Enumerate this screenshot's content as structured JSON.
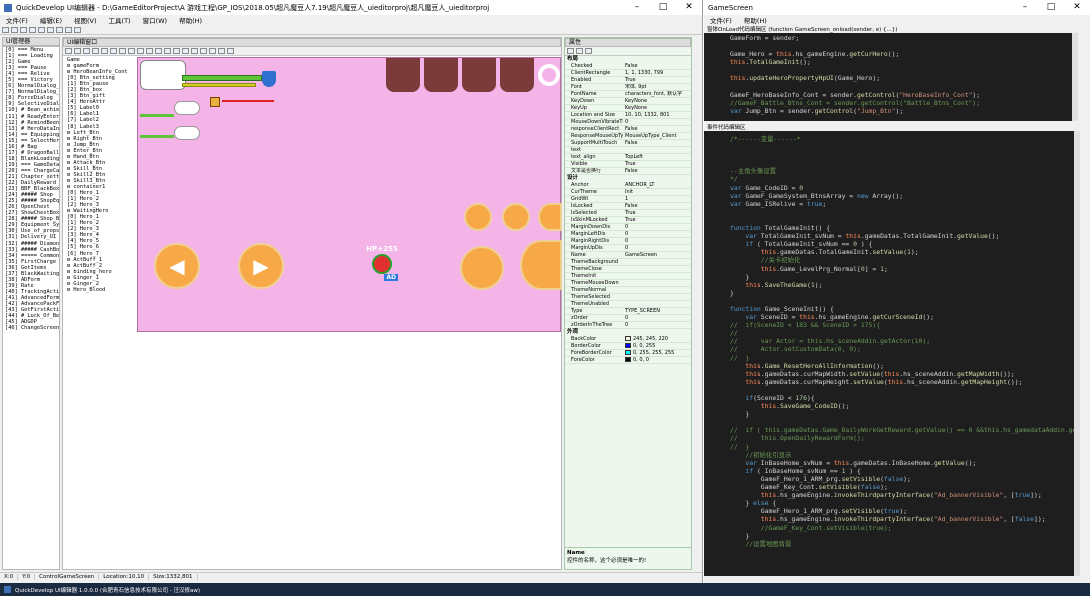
{
  "main_window": {
    "title": "QuickDevelop UI编辑器 - D:\\GameEditorProject\\A 游戏工程\\GP_IOS\\2018.05\\超凡魔豆人7.19\\超凡魔豆人_uieditorproj\\超凡魔豆人_uieditorproj",
    "menu": [
      "文件(F)",
      "编辑(E)",
      "视图(V)",
      "工具(T)",
      "窗口(W)",
      "帮助(H)"
    ],
    "ui_manager_title": "UI管理器",
    "ui_editor_title": "UI编辑窗口",
    "properties_title": "属性",
    "ui_list": [
      "[0] === Menu",
      "[1] === Loading",
      "[2] Game",
      "[3] === Pause",
      "[4] === Relive",
      "[5] === Victory",
      "[6] NormalDialog_left",
      "[7] NormalDialog_right",
      "[8] ForceDialog",
      "[9] SelectiveDialogue",
      "[10] # Bean_achieve",
      "[11] # ReadyEnterGame",
      "[12] # RemindBeenGame",
      "[13] # HeroDataInterface",
      "[14]  == Equipping",
      "[15]  == SelectHeroEquip",
      "[16]  # Bag",
      "[17]  # DragonBall",
      "[18] BlankLoading",
      "[19] === GameDatas",
      "[20] === ChargeCallback",
      "[21] Chapter_settlement",
      "[22] DailyReward",
      "[23] BBF_BlackBox",
      "[24] ##### Shop",
      "[25] ##### ShopEquipUp",
      "[26] OpenChest",
      "[27] ShowChestBox",
      "[28] ##### Shop_Box",
      "[29] Equipment Synthesis",
      "[30] Use_of_props",
      "[31] Delivery_UI",
      "[32] ##### DiamondBox",
      "[33] ##### CashBox",
      "[34] ===== CommonTipsBox",
      "[35] FirstCharge",
      "[36] GetItems",
      "[37] BlackWaiting",
      "[38] ADForm",
      "[39] Rate",
      "[40] TrackingActionForm",
      "[41] AdvancedForm",
      "[42] AdvancePackForm",
      "[43] GetFirstActivityForm",
      "[44] # Luck_Of_Bean",
      "[45] ADGDP",
      "[46] ChangeScreenLoading"
    ],
    "ui_tree": [
      "Game",
      "  ⊟ gameForm",
      "    ⊟ HeroBeanInfo_Cont",
      "      [0] Btn_setting",
      "      [1] Btn_pause",
      "      [2] Btn_box",
      "      [3] Btn_gift",
      "      [4] HeroAttr",
      "      [5] Label0",
      "      [6] Label1",
      "      [7] Label2",
      "      [8] Label3",
      "    ⊟ Left_Btn",
      "    ⊟ Right_Btn",
      "    ⊟ Jump_Btn",
      "    ⊟ Enter_Btn",
      "    ⊟ Hand_Btn",
      "    ⊟ Attack_Btn",
      "    ⊟ Skill_Btn",
      "    ⊟ Skill2_Btn",
      "    ⊟ Skill3_Btn",
      "    ⊟ container1",
      "      [0] Hero_1",
      "      [1] Hero_2",
      "      [2] Hero_3",
      "    ⊟ WaitingHero",
      "      [0] Hero_1",
      "      [1] Hero_2",
      "      [2] Hero_3",
      "      [3] Hero_4",
      "      [4] Hero_5",
      "      [5] Hero_6",
      "      [6] Hero_7",
      "    ⊟ ActBuff_1",
      "    ⊟ ActBuff_2",
      "    ⊟ binding_hero",
      "    ⊟ Ginger_1",
      "    ⊟ Ginger_2",
      "    ⊟ Hero_Blood"
    ],
    "hp_label": "HP+255",
    "ad_label": "AD",
    "properties": {
      "section_layout": "布局",
      "layout_rows": [
        [
          "Checked",
          "False"
        ],
        [
          "ClientRectangle",
          "1, 1, 1330, 799"
        ],
        [
          "Enabled",
          "True"
        ],
        [
          "Font",
          "宋体, 9pt"
        ],
        [
          "FontName",
          "characters_font, 默认字"
        ],
        [
          "KeyDown",
          "KeyNone"
        ],
        [
          "KeyUp",
          "KeyNone"
        ],
        [
          "Location and Size",
          "10, 10, 1332, 801"
        ],
        [
          "MouseDownVibrateTime",
          "0"
        ],
        [
          "responseClientRect",
          "False"
        ],
        [
          "ResponseMouseUpType",
          "MouseUpType_Client"
        ],
        [
          "SupportMultiTouch",
          "False"
        ],
        [
          "text",
          ""
        ],
        [
          "text_align",
          "TopLeft"
        ],
        [
          "Visible",
          "True"
        ],
        [
          "文本是否换行",
          "False"
        ]
      ],
      "section_design": "设计",
      "design_rows": [
        [
          "Anchor",
          "ANCHOR_LT"
        ],
        [
          "CurTheme",
          "Init"
        ],
        [
          "GridWt",
          "1"
        ],
        [
          "IsLocked",
          "False"
        ],
        [
          "IsSelected",
          "True"
        ],
        [
          "IsSkinMLocked",
          "True"
        ],
        [
          "MarginDownDis",
          "0"
        ],
        [
          "MarginLeftDis",
          "0"
        ],
        [
          "MarginRightDis",
          "0"
        ],
        [
          "MarginUpDis",
          "0"
        ],
        [
          "Name",
          "GameScreen"
        ],
        [
          "ThemeBackground",
          ""
        ],
        [
          "ThemeClose",
          ""
        ],
        [
          "ThemeInit",
          ""
        ],
        [
          "ThemeMouseDown",
          ""
        ],
        [
          "ThemeNormal",
          ""
        ],
        [
          "ThemeSelected",
          ""
        ],
        [
          "ThemeUnabled",
          ""
        ],
        [
          "Type",
          "TYPE_SCREEN"
        ],
        [
          "zOrder",
          "0"
        ],
        [
          "zOrderInTheTree",
          "0"
        ]
      ],
      "section_appearance": "外观",
      "appearance_rows": [
        [
          "BackColor",
          "245, 245, 220",
          "#f5f5dc"
        ],
        [
          "BorderColor",
          "0, 0, 255",
          "#0000ff"
        ],
        [
          "ForeBorderColor",
          "0, 255, 255, 255",
          "#00ffff"
        ],
        [
          "ForeColor",
          "0, 0, 0",
          "#000000"
        ]
      ],
      "desc_name": "Name",
      "desc_text": "控件的名称，这个必须是唯一的!"
    },
    "status": [
      "X:0",
      "Y:0",
      "ControlGameScreen",
      "Location:10,10",
      "Size:1332,801"
    ],
    "taskbar_title": "QuickDevelop UI编辑器 1.0.0.0 (合肥青石信息技术有限公司 - 汪汉修aw)"
  },
  "code_window": {
    "title": "GameScreen",
    "menu": [
      "文件(F)",
      "帮助(H)"
    ],
    "sub_title": "窗体OnLoad代码编辑区 (function GameScreen_onload(sender, e) {...})",
    "event_title": "事件代码编辑区",
    "top_lines": [
      "GameForm = sender;",
      "",
      "Game_Hero = this.hs_gameEngine.getCurHero();",
      "this.TotalGameInit();",
      "",
      "this.updateHeroPropertyHpUI(Game_Hero);",
      "",
      "GameF_HeroBaseInfo_Cont = sender.getControl(\"HeroBaseInfo_Cont\");",
      "//GameF_Battle_Btns_Cont = sender.getControl(\"Battle_Btns_Cont\");",
      "var Jump_Btn = sender.getControl(\"Jump_Btn\");"
    ],
    "event_lines": [
      "/*------变量------*",
      "",
      "",
      "",
      "--主角头像设置",
      "*/",
      "var Game_CodeID = 0",
      "var GameF_GameSystem_BtnsArray = new Array();",
      "var Game_ISRelive = true;",
      "",
      "",
      "function TotalGameInit() {",
      "    var TotalGameInit_svNum = this.gameDatas.TotalGameInit.getValue();",
      "    if ( TotalGameInit_svNum == 0 ) {",
      "        this.gameDatas.TotalGameInit.setValue(1);",
      "        //关卡初始化",
      "        this.Game_LevelPrg_Normal[0] = 1;",
      "    }",
      "    this.SaveTheGame(1);",
      "}",
      "",
      "function Game_SceneInit() {",
      "    var SceneID = this.hs_gameEngine.getCurSceneId();",
      "//  if(SceneID < 183 && SceneID > 175){",
      "//",
      "//      var Actor = this.hs_sceneAddin.getActor(10);",
      "//      Actor.setCustomData(0, 0);",
      "//  }",
      "    this.Game_ResetHeroAllInformation();",
      "    this.gameDatas.curMapWidth.setValue(this.hs_sceneAddin.getMapWidth());",
      "    this.gameDatas.curMapHeight.setValue(this.hs_sceneAddin.getMapHeight());",
      "",
      "    if(SceneID < 176){",
      "        this.SaveGame_CodeID();",
      "    }",
      "",
      "//  if ( this.gameDatas.Game_DailyWorkGetReward.getValue() == 0 &&this.hs_gamedataAddin.getSystemVariable",
      "//      this.OpenDailyRewardForm();",
      "//  }",
      "    //初始化引显示",
      "    var InBaseHome_svNum = this.gameDatas.InBaseHome.getValue();",
      "    if ( InBaseHome_svNum == 1 ) {",
      "        GameF_Hero_1_ARM_prg.setVisible(false);",
      "        GameF_Key_Cont.setVisible(false);",
      "        this.hs_gameEngine.invokeThirdpartyInterface(\"Ad_bannerVisible\", [true]);",
      "    } else {",
      "        GameF_Hero_1_ARM_prg.setVisible(true);",
      "        this.hs_gameEngine.invokeThirdpartyInterface(\"Ad_bannerVisible\", [false]);",
      "        //GameF_Key_Cont.setVisible(true);",
      "    }",
      "    //设置地图背景"
    ]
  }
}
